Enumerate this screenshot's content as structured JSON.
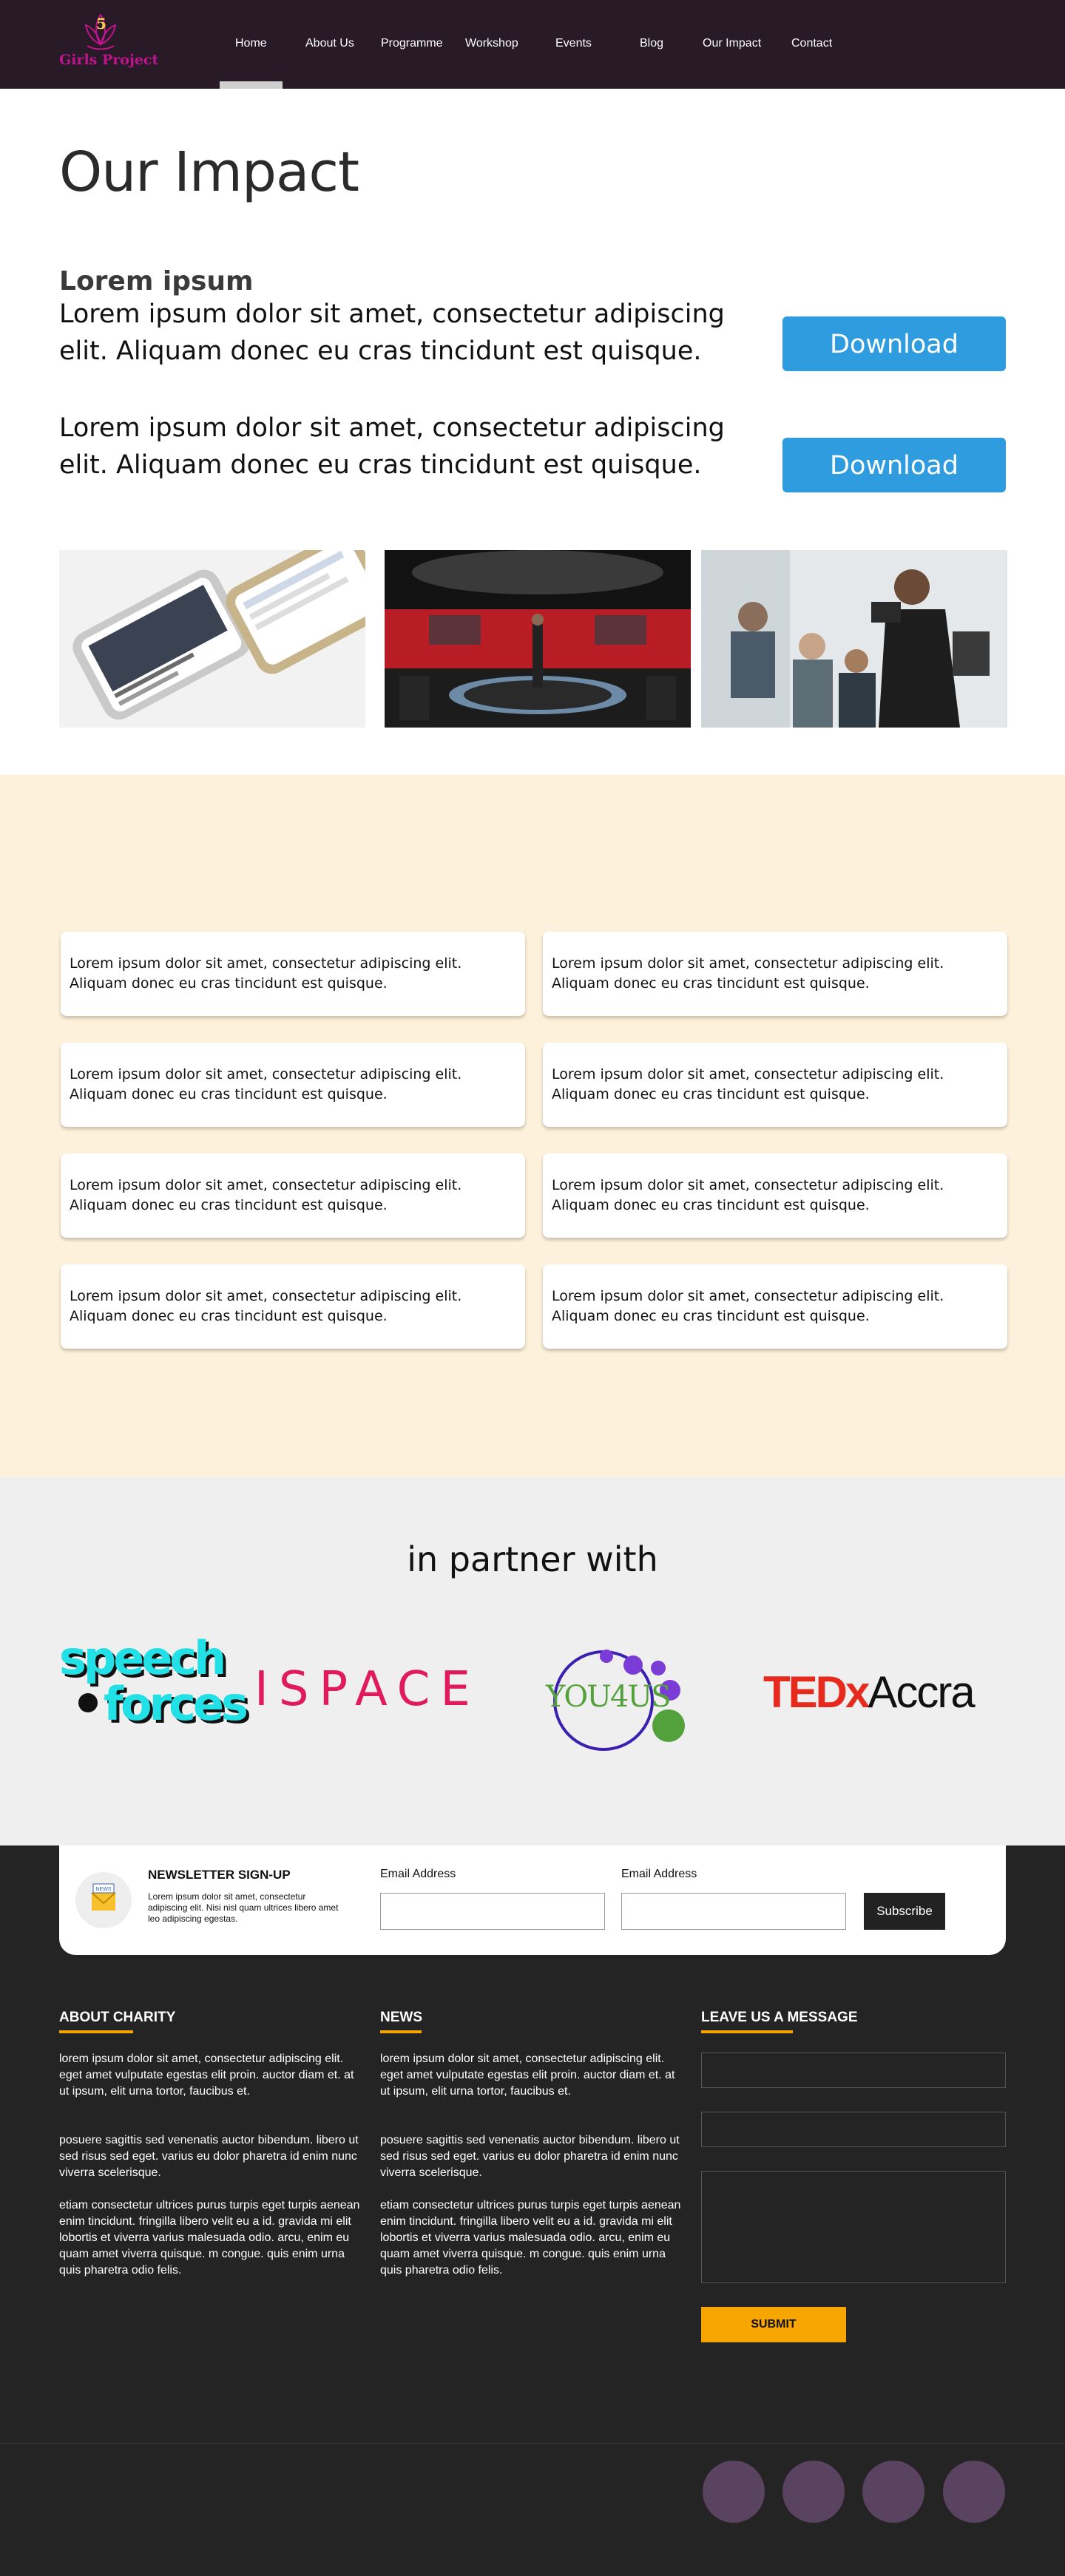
{
  "brand": {
    "logo_text": "Girls Project",
    "logo_number": "5"
  },
  "nav": {
    "items": [
      {
        "label": "Home",
        "active": true
      },
      {
        "label": "About Us"
      },
      {
        "label": "Programme"
      },
      {
        "label": "Workshop"
      },
      {
        "label": "Events"
      },
      {
        "label": "Blog"
      },
      {
        "label": "Our Impact"
      },
      {
        "label": "Contact"
      }
    ]
  },
  "impact": {
    "title": "Our Impact",
    "subtitle": "Lorem ipsum",
    "rows": [
      {
        "text": "Lorem ipsum dolor sit amet, consectetur adipiscing elit. Aliquam donec eu cras tincidunt est quisque.",
        "button": "Download"
      },
      {
        "text": "Lorem ipsum dolor sit amet, consectetur adipiscing elit. Aliquam donec eu cras tincidunt est quisque.",
        "button": "Download"
      }
    ]
  },
  "cards": [
    "Lorem ipsum dolor sit amet, consectetur adipiscing elit. Aliquam donec eu cras tincidunt est quisque.",
    "Lorem ipsum dolor sit amet, consectetur adipiscing elit. Aliquam donec eu cras tincidunt est quisque.",
    "Lorem ipsum dolor sit amet, consectetur adipiscing elit. Aliquam donec eu cras tincidunt est quisque.",
    "Lorem ipsum dolor sit amet, consectetur adipiscing elit. Aliquam donec eu cras tincidunt est quisque.",
    "Lorem ipsum dolor sit amet, consectetur adipiscing elit. Aliquam donec eu cras tincidunt est quisque.",
    "Lorem ipsum dolor sit amet, consectetur adipiscing elit. Aliquam donec eu cras tincidunt est quisque.",
    "Lorem ipsum dolor sit amet, consectetur adipiscing elit. Aliquam donec eu cras tincidunt est quisque.",
    "Lorem ipsum dolor sit amet, consectetur adipiscing elit. Aliquam donec eu cras tincidunt est quisque."
  ],
  "partners": {
    "title": "in partner with",
    "logos": [
      {
        "line1": "speech",
        "line2": "forces"
      },
      {
        "text": "ISPACE"
      },
      {
        "text": "YOU4US"
      },
      {
        "ted": "TEDx",
        "accra": "Accra"
      }
    ]
  },
  "newsletter": {
    "icon_text": "NEWS",
    "title": "NEWSLETTER SIGN-UP",
    "description": "Lorem ipsum dolor sit amet, consectetur adipiscing elit. Nisi nisl quam ultrices libero amet leo adipiscing egestas.",
    "field1_label": "Email Address",
    "field2_label": "Email Address",
    "button": "Subscribe"
  },
  "footer": {
    "about": {
      "heading": "ABOUT CHARITY",
      "paragraphs": [
        "lorem ipsum dolor sit amet, consectetur adipiscing elit. eget amet vulputate egestas elit proin. auctor diam et. at ut ipsum, elit urna tortor, faucibus et.",
        "posuere sagittis sed venenatis auctor bibendum. libero ut sed risus sed eget. varius eu dolor pharetra id enim nunc viverra scelerisque.",
        "etiam consectetur ultrices purus turpis eget turpis aenean enim tincidunt. fringilla libero velit eu a id. gravida mi elit lobortis et viverra varius malesuada odio. arcu, enim eu quam amet viverra quisque. m congue. quis enim urna quis pharetra odio felis."
      ]
    },
    "news": {
      "heading": "NEWS",
      "paragraphs": [
        "lorem ipsum dolor sit amet, consectetur adipiscing elit. eget amet vulputate egestas elit proin. auctor diam et. at ut ipsum, elit urna tortor, faucibus et.",
        "posuere sagittis sed venenatis auctor bibendum. libero ut sed risus sed eget. varius eu dolor pharetra id enim nunc viverra scelerisque.",
        "etiam consectetur ultrices purus turpis eget turpis aenean enim tincidunt. fringilla libero velit eu a id. gravida mi elit lobortis et viverra varius malesuada odio. arcu, enim eu quam amet viverra quisque. m congue. quis enim urna quis pharetra odio felis."
      ]
    },
    "message": {
      "heading": "LEAVE US A MESSAGE",
      "submit": "SUBMIT"
    }
  },
  "colors": {
    "nav_bg": "#291a27",
    "accent_blue": "#2f9ce0",
    "cream_bg": "#fef1db",
    "partners_bg": "#efefef",
    "footer_bg": "#242424",
    "footer_accent": "#f7a500",
    "social_circle": "#5a4360",
    "logo_magenta": "#c0148c"
  }
}
